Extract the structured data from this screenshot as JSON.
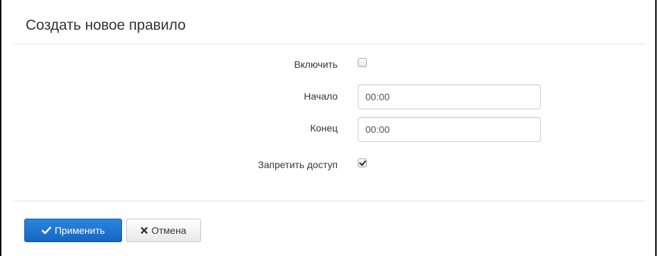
{
  "form": {
    "title": "Создать новое правило",
    "fields": {
      "enable": {
        "label": "Включить",
        "checked": false
      },
      "start": {
        "label": "Начало",
        "value": "00:00"
      },
      "end": {
        "label": "Конец",
        "value": "00:00"
      },
      "deny_access": {
        "label": "Запретить доступ",
        "checked": true
      }
    }
  },
  "actions": {
    "apply_label": "Применить",
    "cancel_label": "Отмена"
  },
  "icons": {
    "apply": "check-icon",
    "cancel": "close-icon"
  },
  "colors": {
    "primary": "#1f78d1",
    "text": "#333333",
    "divider": "#e5e5e5"
  }
}
